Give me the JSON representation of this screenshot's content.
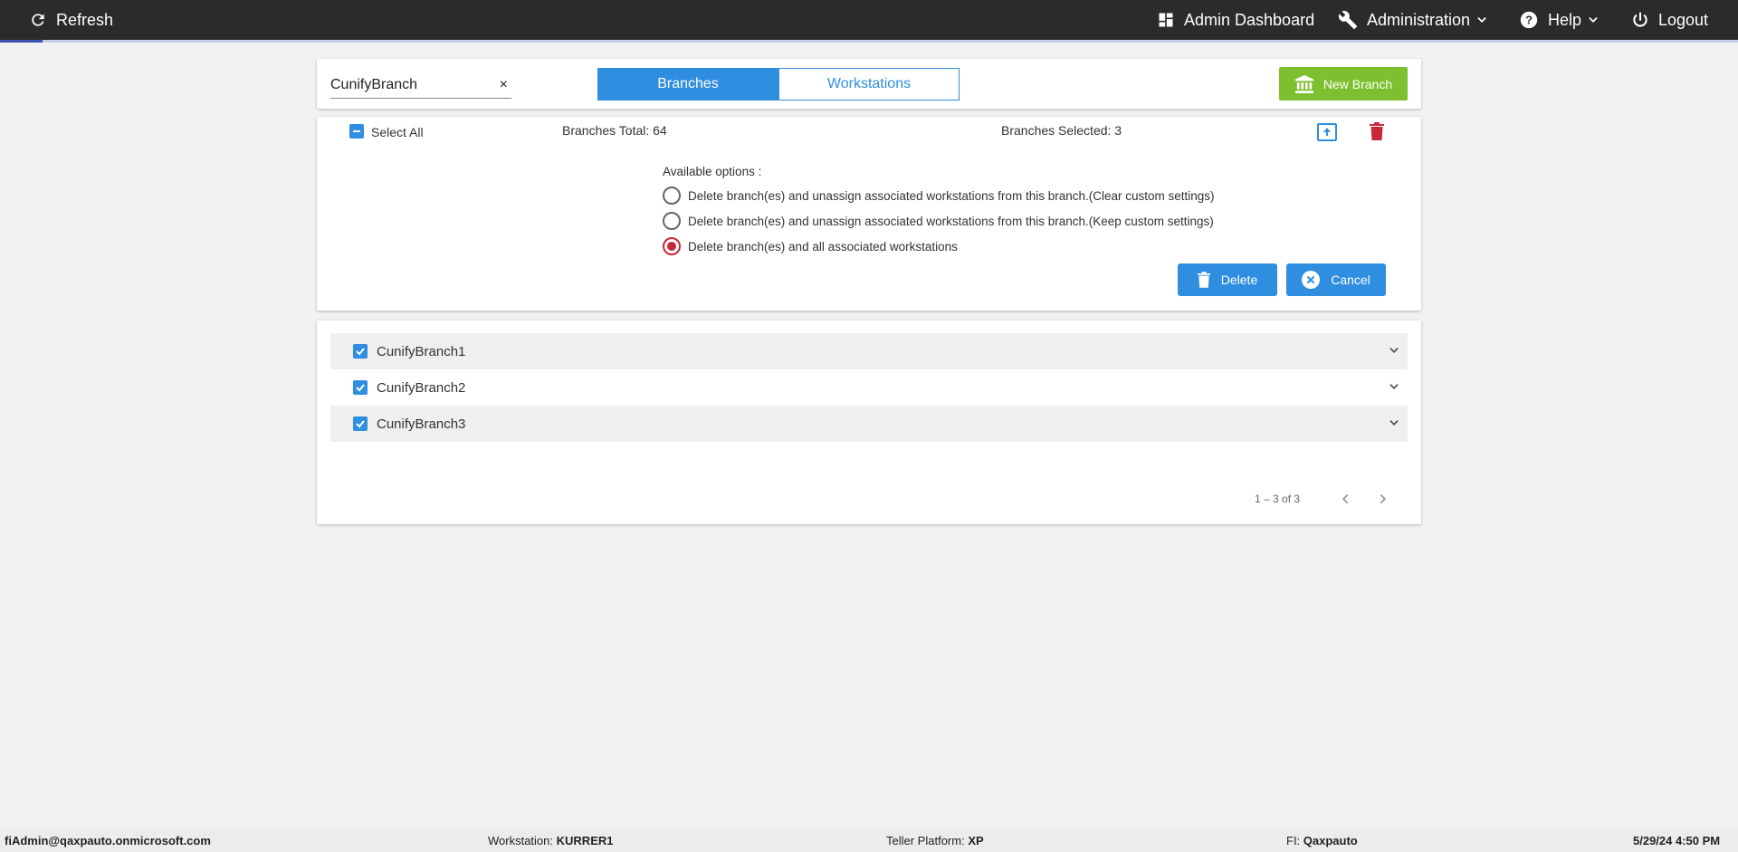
{
  "topbar": {
    "refresh_label": "Refresh",
    "admin_dashboard_label": "Admin Dashboard",
    "administration_label": "Administration",
    "help_label": "Help",
    "logout_label": "Logout"
  },
  "search": {
    "value": "CunifyBranch",
    "clear_glyph": "×"
  },
  "tabs": [
    {
      "label": "Branches",
      "active": true
    },
    {
      "label": "Workstations",
      "active": false
    }
  ],
  "new_branch_label": "New Branch",
  "summary": {
    "select_all_label": "Select All",
    "branches_total": "Branches Total: 64",
    "branches_selected": "Branches Selected: 3"
  },
  "delete_panel": {
    "title": "Available options :",
    "options": [
      {
        "label": "Delete branch(es) and unassign associated workstations from this branch.(Clear custom settings)",
        "checked": false
      },
      {
        "label": "Delete branch(es) and unassign associated workstations from this branch.(Keep custom settings)",
        "checked": false
      },
      {
        "label": "Delete branch(es) and all associated workstations",
        "checked": true
      }
    ],
    "delete_label": "Delete",
    "cancel_label": "Cancel"
  },
  "branches": [
    {
      "name": "CunifyBranch1",
      "checked": true
    },
    {
      "name": "CunifyBranch2",
      "checked": true
    },
    {
      "name": "CunifyBranch3",
      "checked": true
    }
  ],
  "pagination": {
    "range": "1 – 3 of 3"
  },
  "footer": {
    "user": "fiAdmin@qaxpauto.onmicrosoft.com",
    "workstation_label": "Workstation:",
    "workstation_value": "KURRER1",
    "platform_label": "Teller Platform:",
    "platform_value": "XP",
    "fi_label": "FI:",
    "fi_value": "Qaxpauto",
    "datetime": "5/29/24 4:50 PM"
  },
  "colors": {
    "primary": "#2f8ee0",
    "success": "#7dbf2e",
    "danger": "#c62838",
    "topbar": "#2b2b2b"
  }
}
